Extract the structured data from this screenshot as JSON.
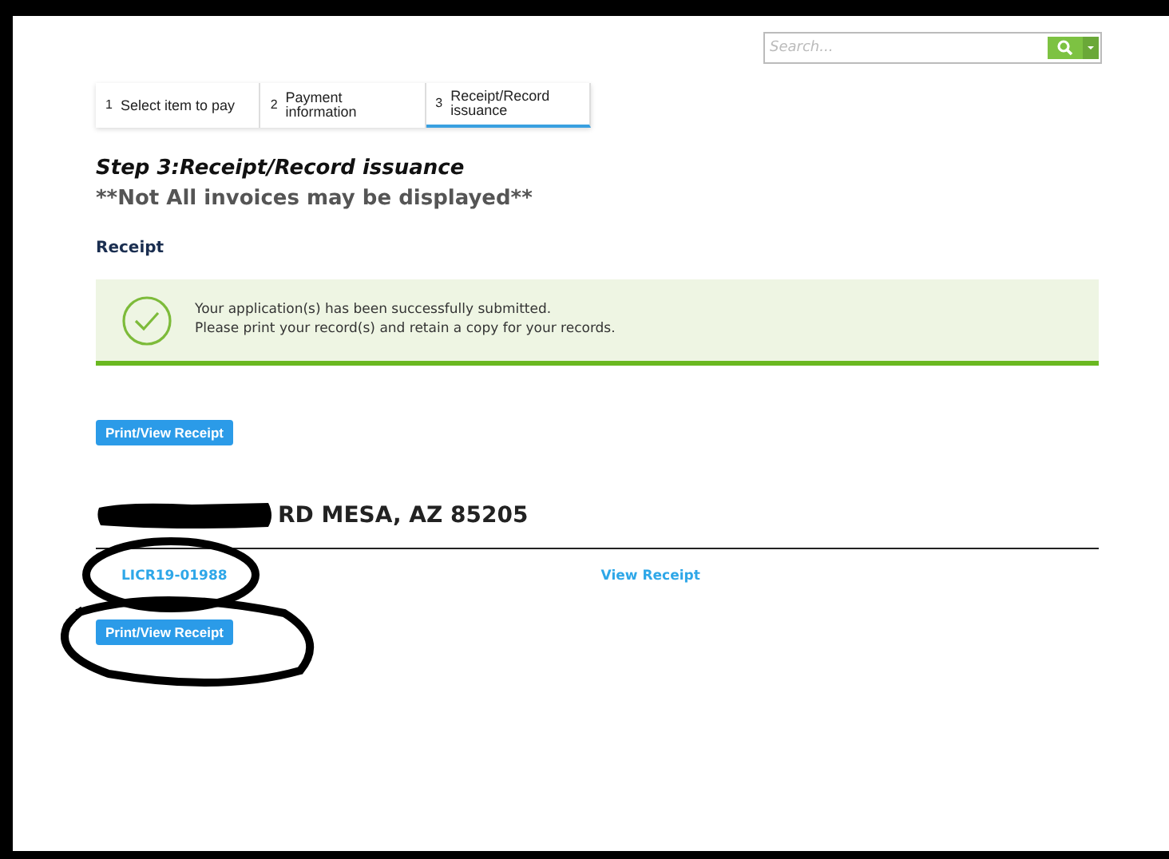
{
  "search": {
    "placeholder": "Search..."
  },
  "steps": [
    {
      "number": "1",
      "label": "Select item to pay",
      "selected": false
    },
    {
      "number": "2",
      "label": "Payment information",
      "selected": false
    },
    {
      "number": "3",
      "label": "Receipt/Record issuance",
      "selected": true
    }
  ],
  "step_title": "Step 3:Receipt/Record issuance",
  "note": "**Not All invoices may be displayed**",
  "section_title": "Receipt",
  "message": {
    "line_1": "Your application(s) has been successfully submitted.",
    "line_2": "Please print your record(s) and retain a copy for your records."
  },
  "print_button_top": "Print/View Receipt",
  "address": "RD MESA, AZ 85205",
  "record": {
    "number": "LICR19-01988",
    "link": "View Receipt"
  },
  "print_button_bottom": "Print/View Receipt"
}
